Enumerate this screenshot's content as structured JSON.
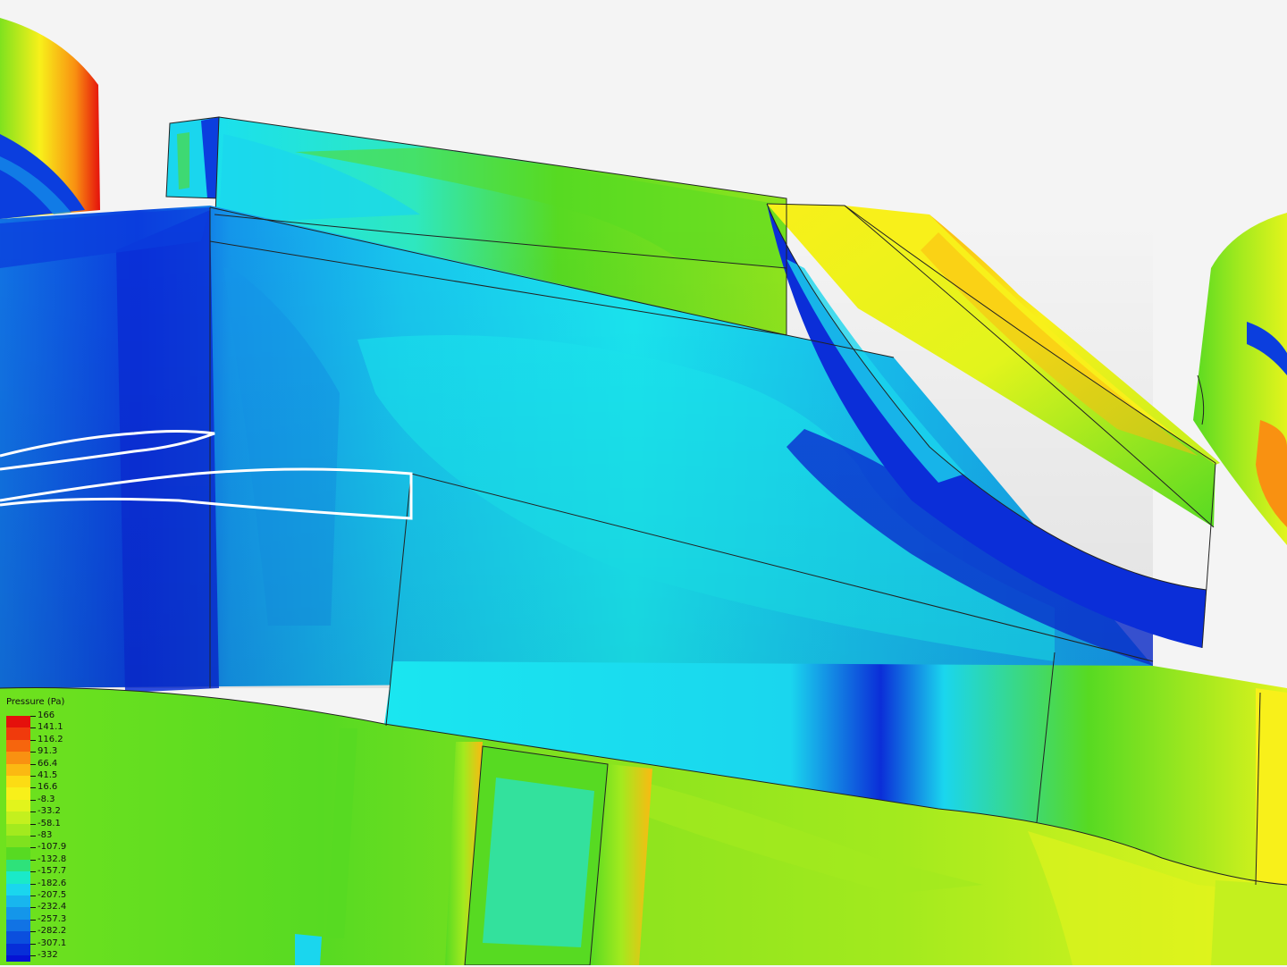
{
  "legend": {
    "title": "Pressure (Pa)",
    "labels": [
      "166",
      "141.1",
      "116.2",
      "91.3",
      "66.4",
      "41.5",
      "16.6",
      "-8.3",
      "-33.2",
      "-58.1",
      "-83",
      "-107.9",
      "-132.8",
      "-157.7",
      "-182.6",
      "-207.5",
      "-232.4",
      "-257.3",
      "-282.2",
      "-307.1",
      "-332"
    ],
    "colors": [
      "#e5100c",
      "#f03a0c",
      "#f6650d",
      "#f99111",
      "#fbb912",
      "#fcdc14",
      "#f8f01a",
      "#e2f41c",
      "#c4f01e",
      "#a3ea1e",
      "#7fe21e",
      "#57da22",
      "#2ee27a",
      "#1aeac8",
      "#1ad6ee",
      "#18b6ee",
      "#1496ea",
      "#1173e4",
      "#0b4fde",
      "#072ed8",
      "#0612d4"
    ]
  },
  "scene": {
    "background": "#f4f4f4",
    "edge_color": "#222222",
    "streamline_color": "#ffffff"
  }
}
